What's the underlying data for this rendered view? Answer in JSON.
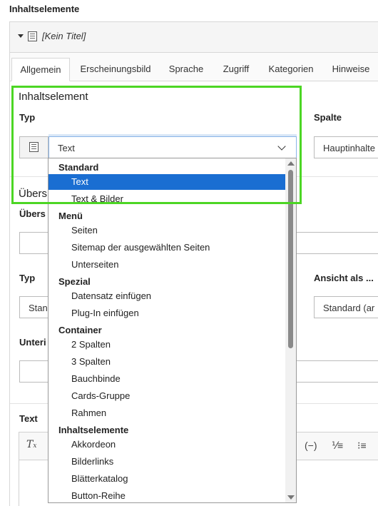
{
  "page": {
    "title": "Inhaltselemente"
  },
  "panel": {
    "title": "[Kein Titel]"
  },
  "tabs": [
    {
      "label": "Allgemein",
      "active": true
    },
    {
      "label": "Erscheinungsbild"
    },
    {
      "label": "Sprache"
    },
    {
      "label": "Zugriff"
    },
    {
      "label": "Kategorien"
    },
    {
      "label": "Hinweise"
    }
  ],
  "form": {
    "section_title": "Inhaltselement",
    "typ_label": "Typ",
    "typ_value": "Text",
    "spalte_label": "Spalte",
    "spalte_value": "Hauptinhalte",
    "uberschrift_section": "Übers",
    "uberschrift_label": "Übers",
    "typ2_label": "Typ",
    "typ2_value": "Stan",
    "ansicht_label": "Ansicht als ...",
    "ansicht_value": "Standard (ar",
    "unteri_label": "Unteri",
    "text_label": "Text"
  },
  "dropdown": {
    "groups": [
      {
        "label": "Standard",
        "items": [
          {
            "label": "Text",
            "selected": true
          },
          {
            "label": "Text & Bilder"
          }
        ]
      },
      {
        "label": "Menü",
        "items": [
          {
            "label": "Seiten"
          },
          {
            "label": "Sitemap der ausgewählten Seiten"
          },
          {
            "label": "Unterseiten"
          }
        ]
      },
      {
        "label": "Spezial",
        "items": [
          {
            "label": "Datensatz einfügen"
          },
          {
            "label": "Plug-In einfügen"
          }
        ]
      },
      {
        "label": "Container",
        "items": [
          {
            "label": "2 Spalten"
          },
          {
            "label": "3 Spalten"
          },
          {
            "label": "Bauchbinde"
          },
          {
            "label": "Cards-Gruppe"
          },
          {
            "label": "Rahmen"
          }
        ]
      },
      {
        "label": "Inhaltselemente",
        "items": [
          {
            "label": "Akkordeon"
          },
          {
            "label": "Bilderlinks"
          },
          {
            "label": "Blätterkatalog"
          },
          {
            "label": "Button-Reihe"
          }
        ]
      }
    ]
  },
  "colors": {
    "highlight": "#4cd624",
    "selected": "#1a6ed2"
  },
  "icons": {
    "clear_format": "clear-format-icon",
    "remove_format": "remove-format-icon",
    "ordered_list": "ordered-list-icon",
    "bullet_list": "bullet-list-icon"
  }
}
